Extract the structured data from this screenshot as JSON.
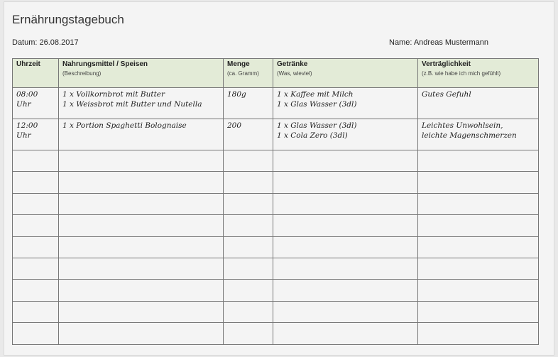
{
  "title": "Ernährungstagebuch",
  "date_label": "Datum: 26.08.2017",
  "name_label": "Name: Andreas Mustermann",
  "columns": [
    {
      "label": "Uhrzeit",
      "sub": ""
    },
    {
      "label": "Nahrungsmittel / Speisen",
      "sub": "(Beschreibung)"
    },
    {
      "label": "Menge",
      "sub": "(ca. Gramm)"
    },
    {
      "label": "Getränke",
      "sub": "(Was, wieviel)"
    },
    {
      "label": "Verträglichkeit",
      "sub": "(z.B. wie habe ich mich gefühlt)"
    }
  ],
  "rows": [
    {
      "time": [
        "08:00",
        "Uhr"
      ],
      "food": [
        "1 x Vollkornbrot mit Butter",
        "1 x Weissbrot mit Butter und Nutella"
      ],
      "amount": "180g",
      "drinks": [
        "1 x Kaffee mit Milch",
        "1 x Glas Wasser (3dl)"
      ],
      "tolerance": [
        "Gutes Gefuhl"
      ]
    },
    {
      "time": [
        "12:00",
        "Uhr"
      ],
      "food": [
        "1 x Portion Spaghetti Bolognaise"
      ],
      "amount": "200",
      "drinks": [
        "1 x Glas Wasser (3dl)",
        "1 x Cola Zero (3dl)"
      ],
      "tolerance": [
        "Leichtes Unwohlsein,",
        "leichte Magenschmerzen"
      ]
    }
  ]
}
